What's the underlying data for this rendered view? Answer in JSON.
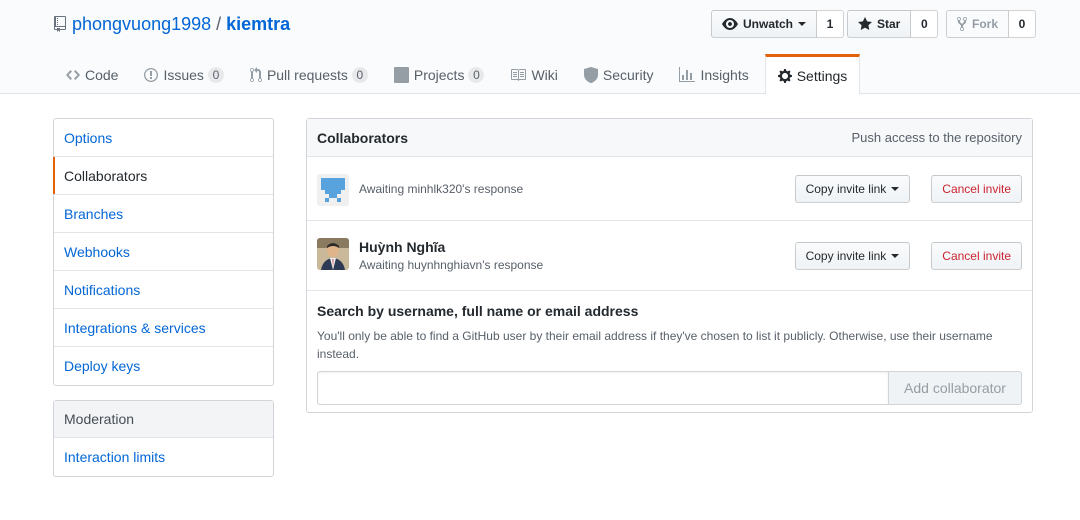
{
  "repo": {
    "owner": "phongvuong1998",
    "separator": "/",
    "name": "kiemtra"
  },
  "actions": {
    "watch": {
      "label": "Unwatch",
      "count": "1"
    },
    "star": {
      "label": "Star",
      "count": "0"
    },
    "fork": {
      "label": "Fork",
      "count": "0"
    }
  },
  "tabs": [
    {
      "label": "Code",
      "icon": "code-icon"
    },
    {
      "label": "Issues",
      "icon": "issue-icon",
      "count": "0"
    },
    {
      "label": "Pull requests",
      "icon": "pull-request-icon",
      "count": "0"
    },
    {
      "label": "Projects",
      "icon": "project-icon",
      "count": "0"
    },
    {
      "label": "Wiki",
      "icon": "book-icon"
    },
    {
      "label": "Security",
      "icon": "shield-icon"
    },
    {
      "label": "Insights",
      "icon": "graph-icon"
    },
    {
      "label": "Settings",
      "icon": "gear-icon",
      "selected": true
    }
  ],
  "sidebar": {
    "items": [
      "Options",
      "Collaborators",
      "Branches",
      "Webhooks",
      "Notifications",
      "Integrations & services",
      "Deploy keys"
    ],
    "selected": "Collaborators",
    "moderation": {
      "heading": "Moderation",
      "items": [
        "Interaction limits"
      ]
    }
  },
  "collaborators": {
    "title": "Collaborators",
    "note": "Push access to the repository",
    "invites": [
      {
        "name": "",
        "awaiting": "Awaiting minhlk320's response",
        "copy_label": "Copy invite link",
        "cancel_label": "Cancel invite"
      },
      {
        "name": "Huỳnh Nghĩa",
        "awaiting": "Awaiting huynhnghiavn's response",
        "copy_label": "Copy invite link",
        "cancel_label": "Cancel invite"
      }
    ],
    "search": {
      "label": "Search by username, full name or email address",
      "note": "You'll only be able to find a GitHub user by their email address if they've chosen to list it publicly. Otherwise, use their username instead.",
      "value": "",
      "button": "Add collaborator"
    }
  },
  "colors": {
    "link": "#0366d6",
    "accent": "#e36209",
    "danger": "#cb2431"
  }
}
